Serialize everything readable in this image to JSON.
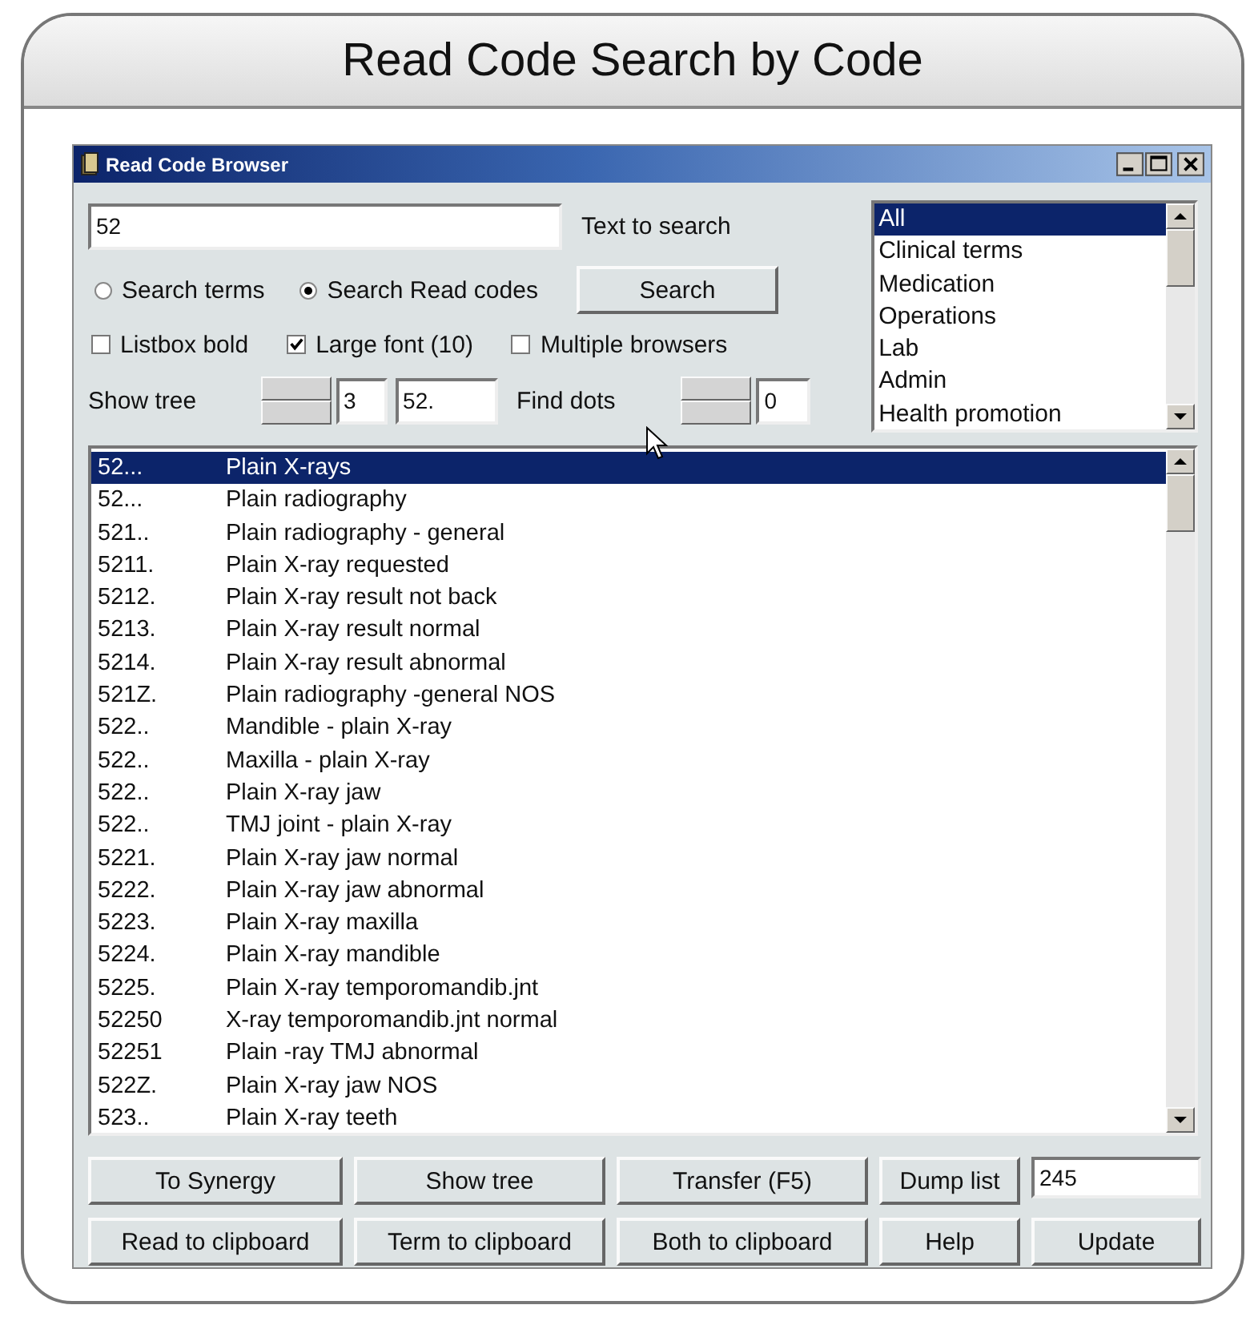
{
  "page_title": "Read Code Search by Code",
  "window": {
    "title": "Read Code Browser"
  },
  "search": {
    "value": "52",
    "label": "Text to search"
  },
  "search_modes": [
    {
      "label": "Search terms",
      "selected": false
    },
    {
      "label": "Search Read codes",
      "selected": true
    }
  ],
  "search_button": "Search",
  "options": [
    {
      "label": "Listbox bold",
      "checked": false
    },
    {
      "label": "Large font (10)",
      "checked": true
    },
    {
      "label": "Multiple browsers",
      "checked": false
    }
  ],
  "show_tree": {
    "label": "Show tree",
    "depth": "3",
    "code": "52."
  },
  "find_dots": {
    "label": "Find dots",
    "value": "0"
  },
  "categories": [
    {
      "label": "All",
      "selected": true
    },
    {
      "label": "Clinical terms",
      "selected": false
    },
    {
      "label": "Medication",
      "selected": false
    },
    {
      "label": "Operations",
      "selected": false
    },
    {
      "label": "Lab",
      "selected": false
    },
    {
      "label": "Admin",
      "selected": false
    },
    {
      "label": "Health promotion",
      "selected": false
    }
  ],
  "results": [
    {
      "code": "52...",
      "term": "Plain X-rays",
      "selected": true
    },
    {
      "code": "52...",
      "term": "Plain radiography",
      "selected": false
    },
    {
      "code": "521..",
      "term": "Plain radiography - general",
      "selected": false
    },
    {
      "code": "5211.",
      "term": "Plain X-ray requested",
      "selected": false
    },
    {
      "code": "5212.",
      "term": "Plain X-ray result not back",
      "selected": false
    },
    {
      "code": "5213.",
      "term": "Plain X-ray result normal",
      "selected": false
    },
    {
      "code": "5214.",
      "term": "Plain X-ray result abnormal",
      "selected": false
    },
    {
      "code": "521Z.",
      "term": "Plain radiography -general NOS",
      "selected": false
    },
    {
      "code": "522..",
      "term": "Mandible - plain X-ray",
      "selected": false
    },
    {
      "code": "522..",
      "term": "Maxilla - plain X-ray",
      "selected": false
    },
    {
      "code": "522..",
      "term": "Plain X-ray jaw",
      "selected": false
    },
    {
      "code": "522..",
      "term": "TMJ joint - plain X-ray",
      "selected": false
    },
    {
      "code": "5221.",
      "term": "Plain X-ray jaw normal",
      "selected": false
    },
    {
      "code": "5222.",
      "term": "Plain X-ray jaw abnormal",
      "selected": false
    },
    {
      "code": "5223.",
      "term": "Plain X-ray maxilla",
      "selected": false
    },
    {
      "code": "5224.",
      "term": "Plain X-ray mandible",
      "selected": false
    },
    {
      "code": "5225.",
      "term": "Plain X-ray temporomandib.jnt",
      "selected": false
    },
    {
      "code": "52250",
      "term": "X-ray temporomandib.jnt normal",
      "selected": false
    },
    {
      "code": "52251",
      "term": "Plain -ray TMJ abnormal",
      "selected": false
    },
    {
      "code": "522Z.",
      "term": "Plain X-ray jaw NOS",
      "selected": false
    },
    {
      "code": "523..",
      "term": "Plain X-ray teeth",
      "selected": false
    }
  ],
  "buttons": [
    {
      "kind": "button",
      "label": "To Synergy"
    },
    {
      "kind": "button",
      "label": "Show tree"
    },
    {
      "kind": "button",
      "label": "Transfer (F5)"
    },
    {
      "kind": "button",
      "label": "Dump list"
    },
    {
      "kind": "field",
      "value": "245"
    },
    {
      "kind": "button",
      "label": "Read to clipboard"
    },
    {
      "kind": "button",
      "label": "Term to clipboard"
    },
    {
      "kind": "button",
      "label": "Both to clipboard"
    },
    {
      "kind": "button",
      "label": "Help"
    },
    {
      "kind": "button",
      "label": "Update"
    }
  ]
}
